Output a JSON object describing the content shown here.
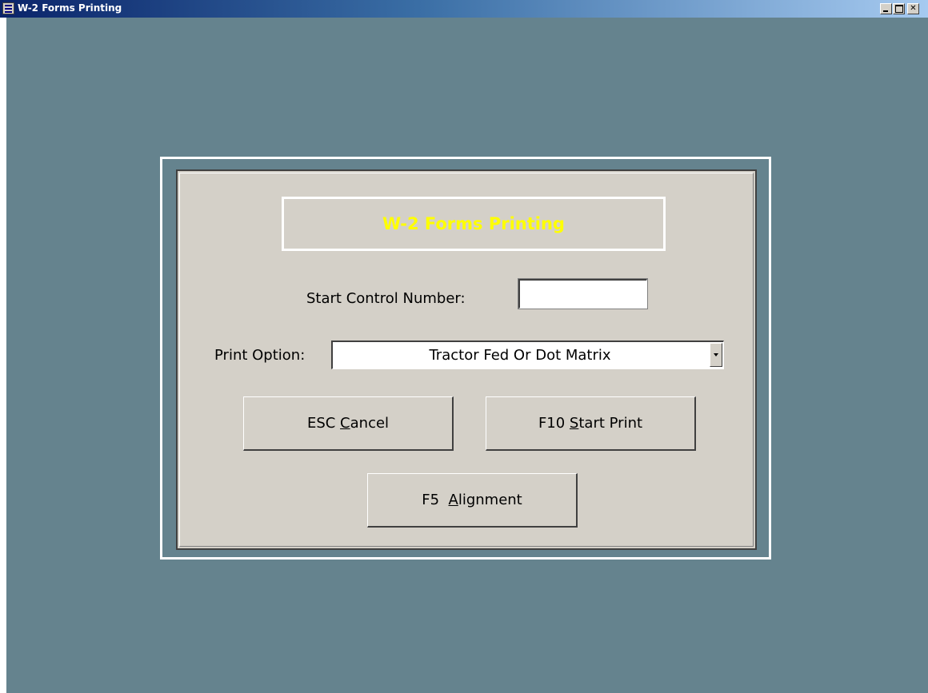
{
  "window": {
    "title": "W-2 Forms Printing",
    "caption_buttons": [
      "minimize",
      "maximize",
      "close"
    ],
    "background_color": "#65838e"
  },
  "dialog": {
    "heading": "W-2 Forms Printing",
    "heading_color": "#ffff00",
    "start_control": {
      "label": "Start Control Number:",
      "value": ""
    },
    "print_option": {
      "label": "Print Option:",
      "selected": "Tractor Fed Or Dot Matrix"
    },
    "buttons": {
      "cancel": {
        "prefix": "ESC ",
        "mnemonic": "C",
        "rest": "ancel"
      },
      "start": {
        "prefix": "F10 ",
        "mnemonic": "S",
        "rest": "tart Print"
      },
      "align": {
        "prefix": "F5  ",
        "mnemonic": "A",
        "rest": "lignment"
      }
    }
  }
}
